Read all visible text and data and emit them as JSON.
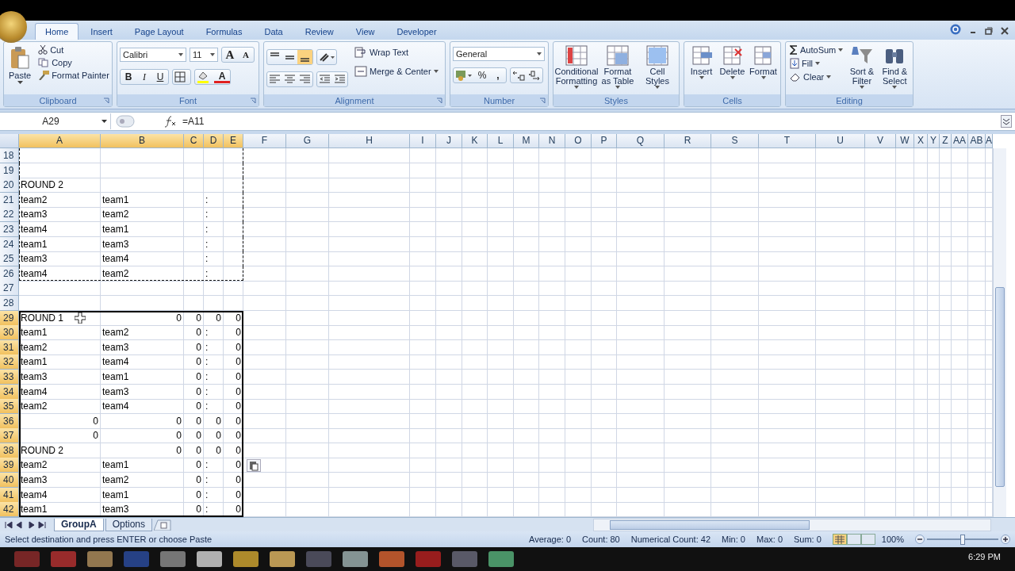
{
  "tabs": [
    {
      "label": "Home",
      "selected": true
    },
    {
      "label": "Insert",
      "selected": false
    },
    {
      "label": "Page Layout",
      "selected": false
    },
    {
      "label": "Formulas",
      "selected": false
    },
    {
      "label": "Data",
      "selected": false
    },
    {
      "label": "Review",
      "selected": false
    },
    {
      "label": "View",
      "selected": false
    },
    {
      "label": "Developer",
      "selected": false
    }
  ],
  "clipboard": {
    "title": "Clipboard",
    "paste": "Paste",
    "cut": "Cut",
    "copy": "Copy",
    "format_painter": "Format Painter"
  },
  "font": {
    "title": "Font",
    "family": "Calibri",
    "size": "11",
    "grow": "A",
    "shrink": "A",
    "bold": "B",
    "italic": "I",
    "underline": "U",
    "color_letter": "A"
  },
  "alignment": {
    "title": "Alignment",
    "vertical": [
      {
        "selected": false
      },
      {
        "selected": false
      },
      {
        "selected": true
      }
    ],
    "wrap": "Wrap Text",
    "merge": "Merge & Center"
  },
  "number": {
    "title": "Number",
    "format": "General",
    "percent": "%",
    "comma": ","
  },
  "styles": {
    "title": "Styles",
    "buttons": [
      "Conditional Formatting",
      "Format as Table",
      "Cell Styles"
    ]
  },
  "cells": {
    "title": "Cells",
    "buttons": [
      "Insert",
      "Delete",
      "Format"
    ]
  },
  "editing": {
    "title": "Editing",
    "autosum": "AutoSum",
    "fill": "Fill",
    "clear": "Clear",
    "sort": "Sort & Filter",
    "find": "Find & Select"
  },
  "name_box": "A29",
  "formula": "=A11",
  "columns": [
    {
      "label": "A",
      "selected": true
    },
    {
      "label": "B",
      "selected": true
    },
    {
      "label": "C",
      "selected": true
    },
    {
      "label": "D",
      "selected": true
    },
    {
      "label": "E",
      "selected": true
    },
    {
      "label": "F",
      "selected": false
    },
    {
      "label": "G",
      "selected": false
    },
    {
      "label": "H",
      "selected": false
    },
    {
      "label": "I",
      "selected": false
    },
    {
      "label": "J",
      "selected": false
    },
    {
      "label": "K",
      "selected": false
    },
    {
      "label": "L",
      "selected": false
    },
    {
      "label": "M",
      "selected": false
    },
    {
      "label": "N",
      "selected": false
    },
    {
      "label": "O",
      "selected": false
    },
    {
      "label": "P",
      "selected": false
    },
    {
      "label": "Q",
      "selected": false
    },
    {
      "label": "R",
      "selected": false
    },
    {
      "label": "S",
      "selected": false
    },
    {
      "label": "T",
      "selected": false
    },
    {
      "label": "U",
      "selected": false
    },
    {
      "label": "V",
      "selected": false
    },
    {
      "label": "W",
      "selected": false
    },
    {
      "label": "X",
      "selected": false
    },
    {
      "label": "Y",
      "selected": false
    },
    {
      "label": "Z",
      "selected": false
    },
    {
      "label": "AA",
      "selected": false
    },
    {
      "label": "AB",
      "selected": false
    },
    {
      "label": "A",
      "selected": false
    }
  ],
  "rows": [
    {
      "row": "18",
      "selected": false,
      "copied": true,
      "cells": []
    },
    {
      "row": "19",
      "selected": false,
      "copied": true,
      "cells": []
    },
    {
      "row": "20",
      "selected": false,
      "copied": true,
      "cells": [
        {
          "kind": "text",
          "text": "ROUND 2"
        }
      ]
    },
    {
      "row": "21",
      "selected": false,
      "copied": true,
      "cells": [
        {
          "kind": "text",
          "text": "team2"
        },
        {
          "kind": "text",
          "text": "team1"
        },
        {
          "kind": "blank"
        },
        {
          "kind": "text",
          "text": ":"
        }
      ]
    },
    {
      "row": "22",
      "selected": false,
      "copied": true,
      "cells": [
        {
          "kind": "text",
          "text": "team3"
        },
        {
          "kind": "text",
          "text": "team2"
        },
        {
          "kind": "blank"
        },
        {
          "kind": "text",
          "text": ":"
        }
      ]
    },
    {
      "row": "23",
      "selected": false,
      "copied": true,
      "cells": [
        {
          "kind": "text",
          "text": "team4"
        },
        {
          "kind": "text",
          "text": "team1"
        },
        {
          "kind": "blank"
        },
        {
          "kind": "text",
          "text": ":"
        }
      ]
    },
    {
      "row": "24",
      "selected": false,
      "copied": true,
      "cells": [
        {
          "kind": "text",
          "text": "team1"
        },
        {
          "kind": "text",
          "text": "team3"
        },
        {
          "kind": "blank"
        },
        {
          "kind": "text",
          "text": ":"
        }
      ]
    },
    {
      "row": "25",
      "selected": false,
      "copied": true,
      "cells": [
        {
          "kind": "text",
          "text": "team3"
        },
        {
          "kind": "text",
          "text": "team4"
        },
        {
          "kind": "blank"
        },
        {
          "kind": "text",
          "text": ":"
        }
      ]
    },
    {
      "row": "26",
      "selected": false,
      "copied": true,
      "cells": [
        {
          "kind": "text",
          "text": "team4"
        },
        {
          "kind": "text",
          "text": "team2"
        },
        {
          "kind": "blank"
        },
        {
          "kind": "text",
          "text": ":"
        }
      ]
    },
    {
      "row": "27",
      "selected": false,
      "copied": false,
      "cells": []
    },
    {
      "row": "28",
      "selected": false,
      "copied": false,
      "cells": []
    },
    {
      "row": "29",
      "selected": true,
      "copied": false,
      "cells": [
        {
          "kind": "text",
          "text": "ROUND 1"
        },
        {
          "kind": "number",
          "text": "0"
        },
        {
          "kind": "number",
          "text": "0"
        },
        {
          "kind": "number",
          "text": "0"
        },
        {
          "kind": "number",
          "text": "0"
        }
      ]
    },
    {
      "row": "30",
      "selected": true,
      "copied": false,
      "cells": [
        {
          "kind": "text",
          "text": "team1"
        },
        {
          "kind": "text",
          "text": "team2"
        },
        {
          "kind": "number",
          "text": "0"
        },
        {
          "kind": "text",
          "text": ":"
        },
        {
          "kind": "number",
          "text": "0"
        }
      ]
    },
    {
      "row": "31",
      "selected": true,
      "copied": false,
      "cells": [
        {
          "kind": "text",
          "text": "team2"
        },
        {
          "kind": "text",
          "text": "team3"
        },
        {
          "kind": "number",
          "text": "0"
        },
        {
          "kind": "text",
          "text": ":"
        },
        {
          "kind": "number",
          "text": "0"
        }
      ]
    },
    {
      "row": "32",
      "selected": true,
      "copied": false,
      "cells": [
        {
          "kind": "text",
          "text": "team1"
        },
        {
          "kind": "text",
          "text": "team4"
        },
        {
          "kind": "number",
          "text": "0"
        },
        {
          "kind": "text",
          "text": ":"
        },
        {
          "kind": "number",
          "text": "0"
        }
      ]
    },
    {
      "row": "33",
      "selected": true,
      "copied": false,
      "cells": [
        {
          "kind": "text",
          "text": "team3"
        },
        {
          "kind": "text",
          "text": "team1"
        },
        {
          "kind": "number",
          "text": "0"
        },
        {
          "kind": "text",
          "text": ":"
        },
        {
          "kind": "number",
          "text": "0"
        }
      ]
    },
    {
      "row": "34",
      "selected": true,
      "copied": false,
      "cells": [
        {
          "kind": "text",
          "text": "team4"
        },
        {
          "kind": "text",
          "text": "team3"
        },
        {
          "kind": "number",
          "text": "0"
        },
        {
          "kind": "text",
          "text": ":"
        },
        {
          "kind": "number",
          "text": "0"
        }
      ]
    },
    {
      "row": "35",
      "selected": true,
      "copied": false,
      "cells": [
        {
          "kind": "text",
          "text": "team2"
        },
        {
          "kind": "text",
          "text": "team4"
        },
        {
          "kind": "number",
          "text": "0"
        },
        {
          "kind": "text",
          "text": ":"
        },
        {
          "kind": "number",
          "text": "0"
        }
      ]
    },
    {
      "row": "36",
      "selected": true,
      "copied": false,
      "cells": [
        {
          "kind": "number",
          "text": "0"
        },
        {
          "kind": "number",
          "text": "0"
        },
        {
          "kind": "number",
          "text": "0"
        },
        {
          "kind": "number",
          "text": "0"
        },
        {
          "kind": "number",
          "text": "0"
        }
      ]
    },
    {
      "row": "37",
      "selected": true,
      "copied": false,
      "cells": [
        {
          "kind": "number",
          "text": "0"
        },
        {
          "kind": "number",
          "text": "0"
        },
        {
          "kind": "number",
          "text": "0"
        },
        {
          "kind": "number",
          "text": "0"
        },
        {
          "kind": "number",
          "text": "0"
        }
      ]
    },
    {
      "row": "38",
      "selected": true,
      "copied": false,
      "cells": [
        {
          "kind": "text",
          "text": "ROUND 2"
        },
        {
          "kind": "number",
          "text": "0"
        },
        {
          "kind": "number",
          "text": "0"
        },
        {
          "kind": "number",
          "text": "0"
        },
        {
          "kind": "number",
          "text": "0"
        }
      ]
    },
    {
      "row": "39",
      "selected": true,
      "copied": false,
      "cells": [
        {
          "kind": "text",
          "text": "team2"
        },
        {
          "kind": "text",
          "text": "team1"
        },
        {
          "kind": "number",
          "text": "0"
        },
        {
          "kind": "text",
          "text": ":"
        },
        {
          "kind": "number",
          "text": "0"
        }
      ]
    },
    {
      "row": "40",
      "selected": true,
      "copied": false,
      "cells": [
        {
          "kind": "text",
          "text": "team3"
        },
        {
          "kind": "text",
          "text": "team2"
        },
        {
          "kind": "number",
          "text": "0"
        },
        {
          "kind": "text",
          "text": ":"
        },
        {
          "kind": "number",
          "text": "0"
        }
      ]
    },
    {
      "row": "41",
      "selected": true,
      "copied": false,
      "cells": [
        {
          "kind": "text",
          "text": "team4"
        },
        {
          "kind": "text",
          "text": "team1"
        },
        {
          "kind": "number",
          "text": "0"
        },
        {
          "kind": "text",
          "text": ":"
        },
        {
          "kind": "number",
          "text": "0"
        }
      ]
    },
    {
      "row": "42",
      "selected": true,
      "copied": false,
      "cells": [
        {
          "kind": "text",
          "text": "team1"
        },
        {
          "kind": "text",
          "text": "team3"
        },
        {
          "kind": "number",
          "text": "0"
        },
        {
          "kind": "text",
          "text": ":"
        },
        {
          "kind": "number",
          "text": "0"
        }
      ]
    }
  ],
  "sheets": [
    {
      "label": "GroupA",
      "selected": true
    },
    {
      "label": "Options",
      "selected": false
    }
  ],
  "status": {
    "message": "Select destination and press ENTER or choose Paste",
    "stats": [
      "Average: 0",
      "Count: 80",
      "Numerical Count: 42",
      "Min: 0",
      "Max: 0",
      "Sum: 0"
    ],
    "zoom": "100%",
    "zoom_slider": {
      "level": 0.5
    }
  },
  "taskbar": {
    "clock": "6:29 PM"
  }
}
